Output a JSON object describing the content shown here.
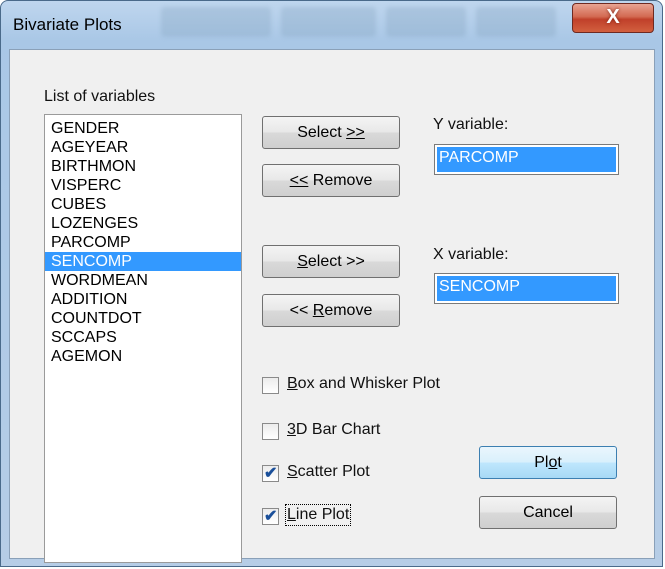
{
  "window": {
    "title": "Bivariate Plots",
    "close_label": "X"
  },
  "variables": {
    "label": "List of variables",
    "items": [
      "GENDER",
      "AGEYEAR",
      "BIRTHMON",
      "VISPERC",
      "CUBES",
      "LOZENGES",
      "PARCOMP",
      "SENCOMP",
      "WORDMEAN",
      "ADDITION",
      "COUNTDOT",
      "SCCAPS",
      "AGEMON"
    ],
    "selected": "SENCOMP"
  },
  "y": {
    "label": "Y variable:",
    "value": "PARCOMP",
    "select_label": "Select >>",
    "remove_label": "<< Remove"
  },
  "x": {
    "label": "X variable:",
    "value": "SENCOMP",
    "select_label": "Select >>",
    "remove_label": "<< Remove"
  },
  "options": [
    {
      "label": "Box and Whisker Plot",
      "checked": false
    },
    {
      "label": "3D Bar Chart",
      "checked": false
    },
    {
      "label": "Scatter Plot",
      "checked": true
    },
    {
      "label": "Line Plot",
      "checked": true
    }
  ],
  "buttons": {
    "plot": "Plot",
    "cancel": "Cancel"
  }
}
